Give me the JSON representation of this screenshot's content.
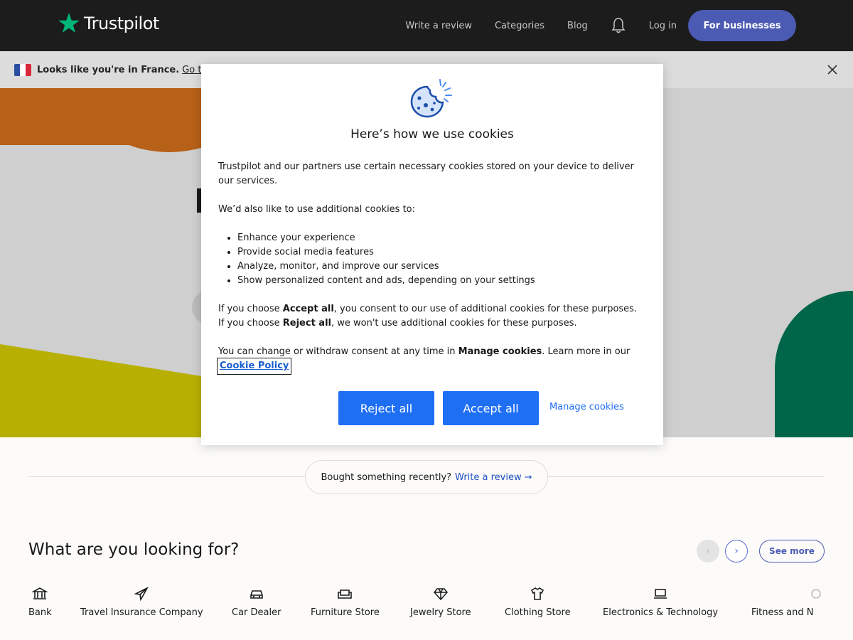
{
  "header": {
    "logo_text": "Trustpilot",
    "nav": {
      "write_review": "Write a review",
      "categories": "Categories",
      "blog": "Blog",
      "login": "Log in",
      "for_businesses": "For businesses"
    }
  },
  "banner": {
    "text": "Looks like you're in France.",
    "link": "Go to"
  },
  "cookie_modal": {
    "title": "Here’s how we use cookies",
    "intro": "Trustpilot and our partners use certain necessary cookies stored on your device to deliver our services.",
    "also": "We’d also like to use additional cookies to:",
    "purposes": [
      "Enhance your experience",
      "Provide social media features",
      "Analyze, monitor, and improve our services",
      "Show personalized content and ads, depending on your settings"
    ],
    "accept_pre": "If you choose ",
    "accept_bold": "Accept all",
    "accept_post": ", you consent to our use of additional cookies for these purposes.",
    "reject_pre": "If you choose ",
    "reject_bold": "Reject all",
    "reject_post": ", we won't use additional cookies for these purposes.",
    "change_pre": "You can change or withdraw consent at any time in ",
    "change_bold": "Manage cookies",
    "change_post": ". Learn more in our",
    "policy_link": "Cookie Policy",
    "reject_button": "Reject all",
    "accept_button": "Accept all",
    "manage_button": "Manage cookies"
  },
  "review_strip": {
    "text": "Bought something recently?",
    "link": "Write a review",
    "arrow": "→"
  },
  "categories": {
    "title": "What are you looking for?",
    "prev": "‹",
    "next": "›",
    "see_more": "See more",
    "items": [
      {
        "label": "Bank",
        "icon": "bank-icon"
      },
      {
        "label": "Travel Insurance Company",
        "icon": "plane-icon"
      },
      {
        "label": "Car Dealer",
        "icon": "car-icon"
      },
      {
        "label": "Furniture Store",
        "icon": "sofa-icon"
      },
      {
        "label": "Jewelry Store",
        "icon": "diamond-icon"
      },
      {
        "label": "Clothing Store",
        "icon": "shirt-icon"
      },
      {
        "label": "Electronics & Technology",
        "icon": "laptop-icon"
      },
      {
        "label": "Fitness and N",
        "icon": "fitness-icon"
      }
    ]
  },
  "colors": {
    "header_bg": "#1c1c1c",
    "accent_blue": "#1f6ff5",
    "business_button": "#4b5bb4",
    "trustpilot_green": "#00b67a"
  }
}
